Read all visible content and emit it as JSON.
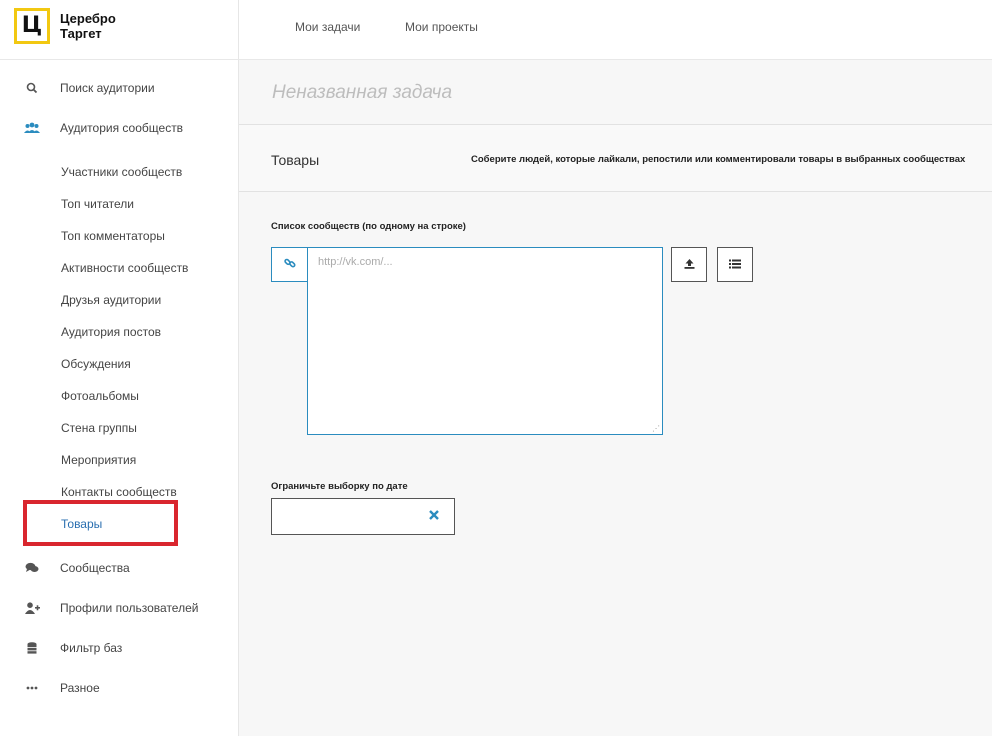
{
  "logo": {
    "mark": "Ц",
    "line1": "Церебро",
    "line2": "Таргет"
  },
  "tabs": [
    "Мои задачи",
    "Мои проекты"
  ],
  "sidebar": {
    "items": [
      {
        "label": "Поиск аудитории",
        "icon": "search-icon"
      },
      {
        "label": "Аудитория сообществ",
        "icon": "users-icon"
      }
    ],
    "sub_items": [
      "Участники сообществ",
      "Топ читатели",
      "Топ комментаторы",
      "Активности сообществ",
      "Друзья аудитории",
      "Аудитория постов",
      "Обсуждения",
      "Фотоальбомы",
      "Стена группы",
      "Мероприятия",
      "Контакты сообществ",
      "Товары"
    ],
    "bottom_items": [
      {
        "label": "Сообщества",
        "icon": "comments-icon"
      },
      {
        "label": "Профили пользователей",
        "icon": "user-plus-icon"
      },
      {
        "label": "Фильтр баз",
        "icon": "database-icon"
      },
      {
        "label": "Разное",
        "icon": "ellipsis-icon"
      }
    ]
  },
  "task": {
    "title": "Неназванная задача"
  },
  "section": {
    "title": "Товары",
    "description": "Соберите людей, которые лайкали, репостили или комментировали товары в выбранных сообществах"
  },
  "form": {
    "communities_label": "Список сообществ (по одному на строке)",
    "communities_placeholder": "http://vk.com/...",
    "date_label": "Ограничьте выборку по дате"
  },
  "colors": {
    "accent": "#2b8cbf",
    "active_link": "#2a6fb0",
    "logo_yellow": "#f2c811",
    "highlight": "#d9262e"
  }
}
